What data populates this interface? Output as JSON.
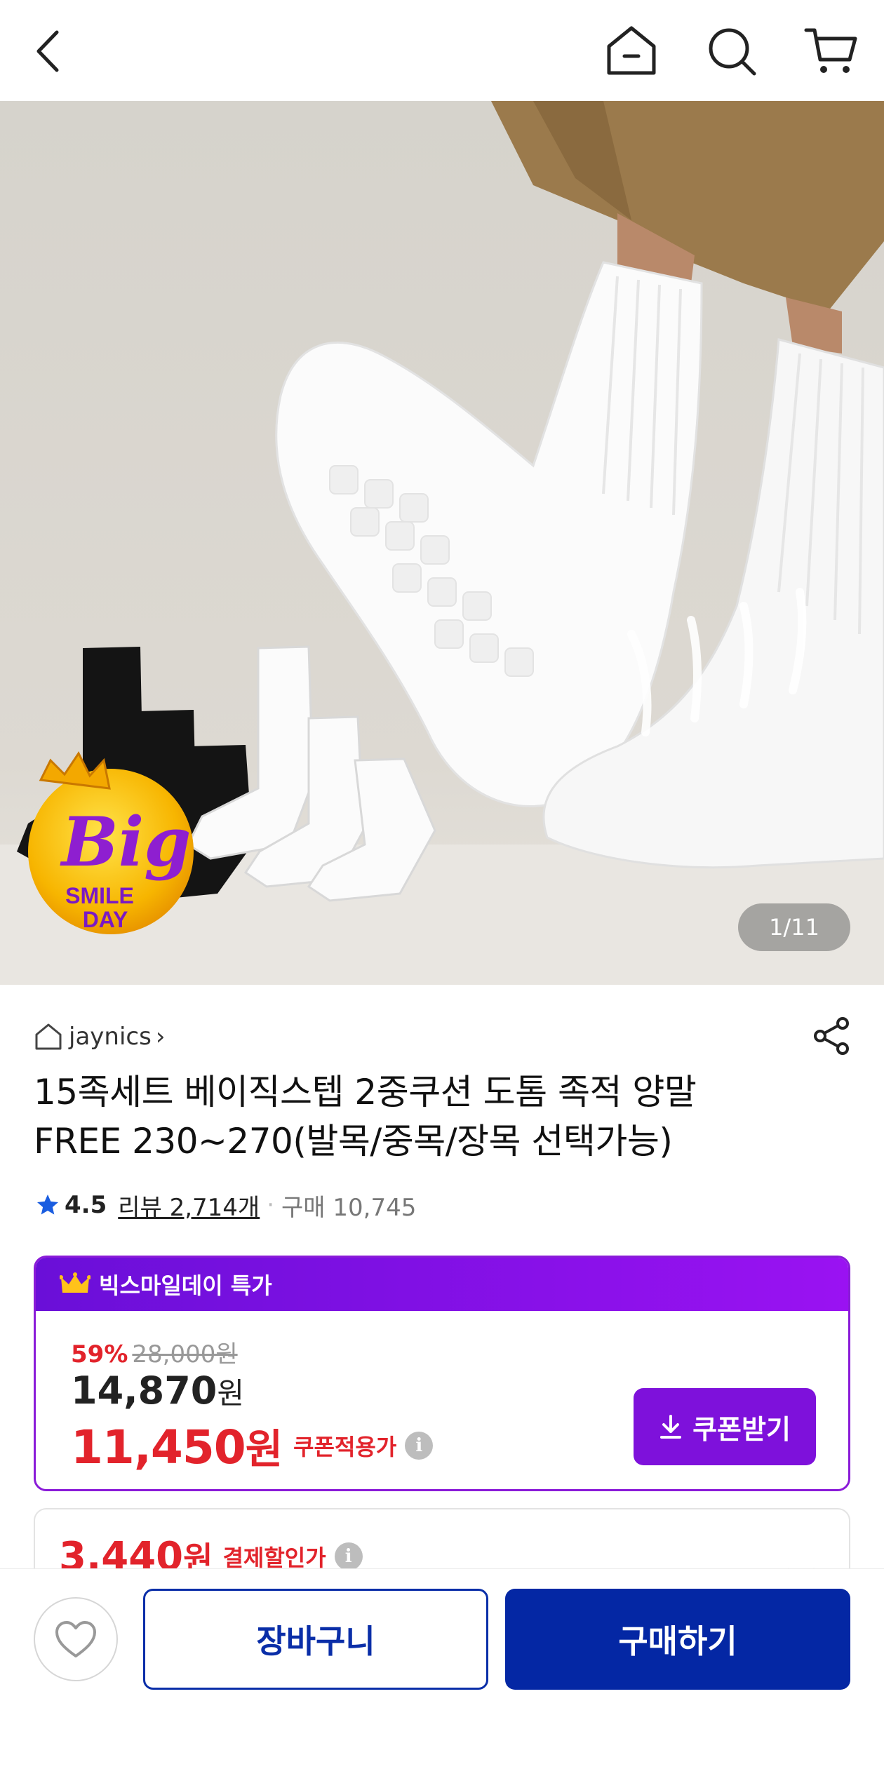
{
  "nav": {
    "icons": [
      "chevron-left-icon",
      "home-icon",
      "search-icon",
      "cart-icon"
    ]
  },
  "hero": {
    "counter": "1/11",
    "badge_big": "Big",
    "badge_line1": "SMILE",
    "badge_line2": "DAY"
  },
  "seller": {
    "name": "jaynics",
    "chevron": "›"
  },
  "product": {
    "title_line1": "15족세트 베이직스텝 2중쿠션 도톰 족적 양말",
    "title_line2": "FREE 230~270(발목/중목/장목 선택가능)",
    "rating": "4.5",
    "review_text": "리뷰 2,714개",
    "separator": "·",
    "purchase_text": "구매 10,745"
  },
  "promo": {
    "banner_text": "빅스마일데이 특가",
    "discount_pct": "59%",
    "original_price": "28,000원",
    "sale_price_num": "14,870",
    "sale_price_unit": "원",
    "coupon_price_num": "11,450",
    "coupon_price_unit": "원",
    "coupon_label": "쿠폰적용가",
    "info": "i",
    "coupon_button": "쿠폰받기"
  },
  "card2": {
    "price_num": "3,440",
    "price_unit": "원",
    "label": "결제할인가",
    "info": "i"
  },
  "bottom": {
    "cart_button": "장바구니",
    "buy_button": "구매하기"
  },
  "colors": {
    "accent_purple": "#7e11db",
    "price_red": "#e2232b",
    "brand_blue": "#0427a4"
  }
}
